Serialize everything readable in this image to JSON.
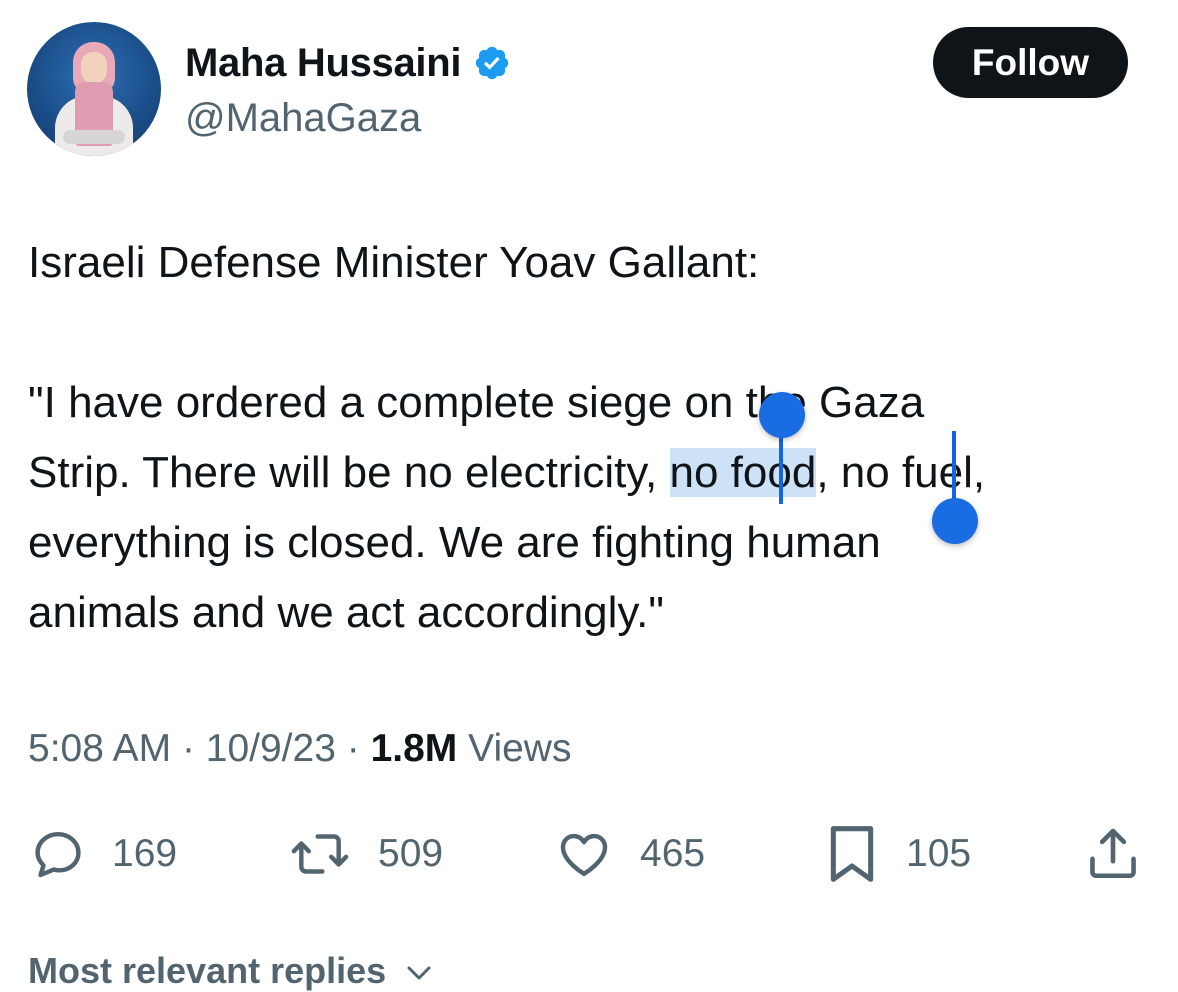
{
  "author": {
    "display_name": "Maha Hussaini",
    "handle": "@MahaGaza",
    "verified": true,
    "verified_color": "#1d9bf0"
  },
  "follow_button": {
    "label": "Follow"
  },
  "tweet": {
    "line1": "Israeli Defense Minister Yoav Gallant:",
    "line2": "\"I have ordered a complete siege on the Gaza",
    "line3_before": "Strip. There will be no electricity, ",
    "line3_selected": "no food",
    "line3_after": ", no fuel,",
    "line4": "everything is closed. We are fighting human",
    "line5": "animals and we act accordingly.\""
  },
  "meta": {
    "time": "5:08 AM",
    "separator": "·",
    "date": "10/9/23",
    "views_count": "1.8M",
    "views_label": "Views"
  },
  "actions": {
    "replies": "169",
    "reposts": "509",
    "likes": "465",
    "bookmarks": "105"
  },
  "replies_section": {
    "label": "Most relevant replies"
  },
  "colors": {
    "text": "#0f1419",
    "secondary": "#536471",
    "selection_handle": "#1a6ce2",
    "follow_bg": "#0f1419"
  }
}
